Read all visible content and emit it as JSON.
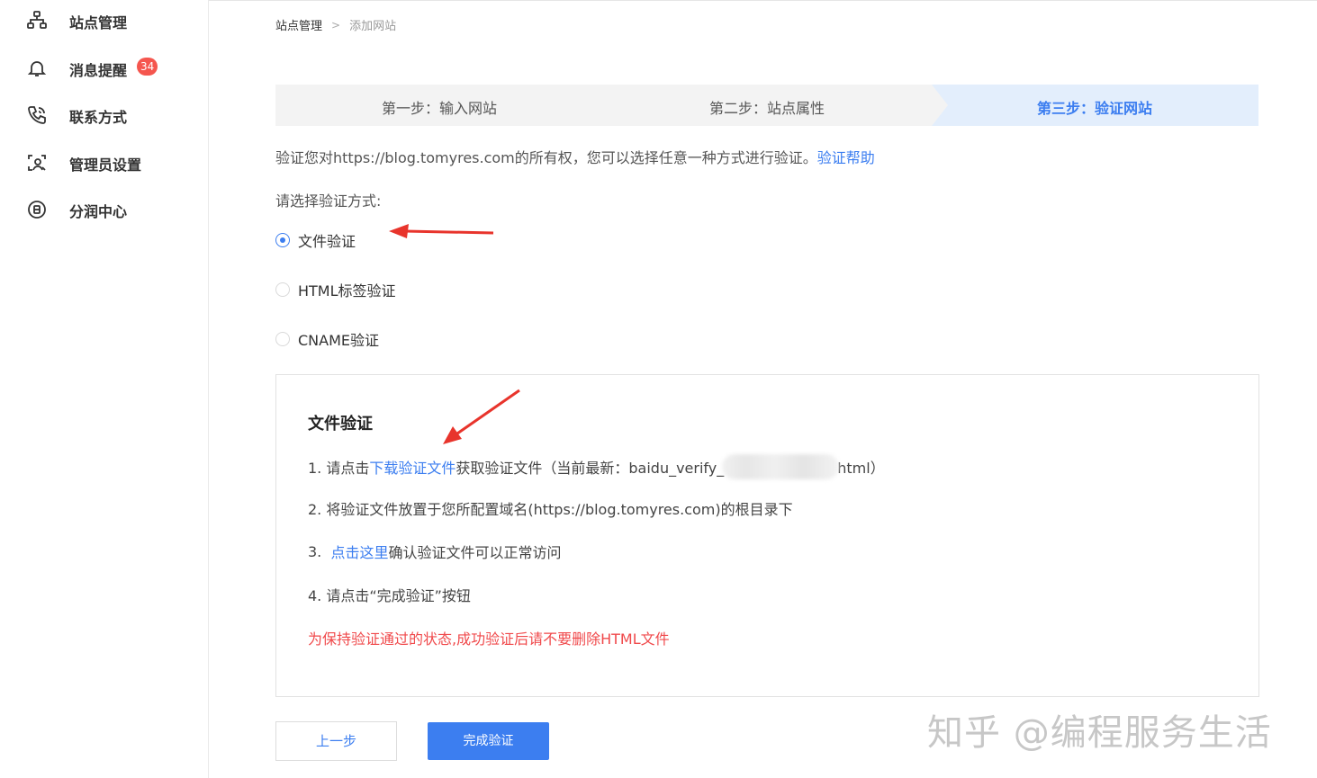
{
  "sidebar": {
    "items": [
      {
        "label": "站点管理",
        "icon": "sitemap-icon"
      },
      {
        "label": "消息提醒",
        "icon": "bell-icon",
        "badge": "34"
      },
      {
        "label": "联系方式",
        "icon": "phone-icon"
      },
      {
        "label": "管理员设置",
        "icon": "admin-user-icon"
      },
      {
        "label": "分润中心",
        "icon": "revenue-icon"
      }
    ]
  },
  "breadcrumb": {
    "root": "站点管理",
    "separator": ">",
    "current": "添加网站"
  },
  "steps": [
    {
      "label": "第一步：输入网站",
      "active": false
    },
    {
      "label": "第二步：站点属性",
      "active": false
    },
    {
      "label": "第三步：验证网站",
      "active": true
    }
  ],
  "description": {
    "text": "验证您对https://blog.tomyres.com的所有权，您可以选择任意一种方式进行验证。",
    "help_link": "验证帮助"
  },
  "method_label": "请选择验证方式:",
  "methods": [
    {
      "label": "文件验证",
      "checked": true
    },
    {
      "label": "HTML标签验证",
      "checked": false
    },
    {
      "label": "CNAME验证",
      "checked": false
    }
  ],
  "file_verify": {
    "title": "文件验证",
    "step1_prefix": "1.  请点击",
    "step1_link": "下载验证文件",
    "step1_middle": "获取验证文件（当前最新：baidu_verify_",
    "step1_suffix": "html）",
    "step2": "2.  将验证文件放置于您所配置域名(https://blog.tomyres.com)的根目录下",
    "step3_prefix": "3.  ",
    "step3_link": "点击这里",
    "step3_suffix": "确认验证文件可以正常访问",
    "step4": "4.  请点击“完成验证”按钮",
    "warning": "为保持验证通过的状态,成功验证后请不要删除HTML文件"
  },
  "buttons": {
    "prev": "上一步",
    "finish": "完成验证"
  },
  "watermark": "知乎 @编程服务生活",
  "colors": {
    "accent": "#3c7ef0",
    "badge": "#f5564e",
    "warning": "#f0494b",
    "step_active_bg": "#e3eefc",
    "step_bg": "#f3f3f3"
  }
}
